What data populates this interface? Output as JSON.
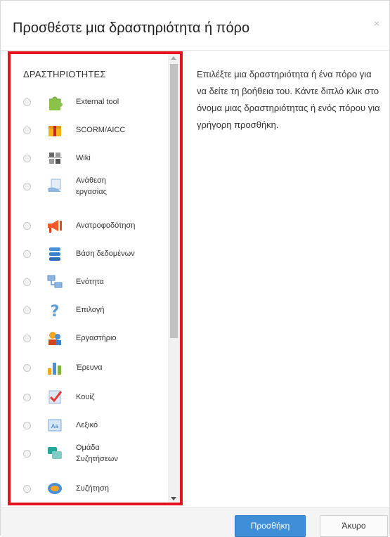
{
  "dialog": {
    "title": "Προσθέστε μια δραστηριότητα ή πόρο",
    "close_glyph": "×"
  },
  "activities": {
    "section_title": "ΔΡΑΣΤΗΡΙΟΤΗΤΕΣ",
    "items": [
      {
        "label": "External tool",
        "icon": "puzzle-icon"
      },
      {
        "label": "SCORM/AICC",
        "icon": "package-icon"
      },
      {
        "label": "Wiki",
        "icon": "wiki-icon"
      },
      {
        "label": "Ανάθεση εργασίας",
        "icon": "assignment-icon"
      },
      {
        "label": "Ανατροφοδότηση",
        "icon": "megaphone-icon"
      },
      {
        "label": "Βάση δεδομένων",
        "icon": "database-icon"
      },
      {
        "label": "Ενότητα",
        "icon": "lesson-icon"
      },
      {
        "label": "Επιλογή",
        "icon": "question-icon"
      },
      {
        "label": "Εργαστήριο",
        "icon": "workshop-icon"
      },
      {
        "label": "Έρευνα",
        "icon": "survey-chart-icon"
      },
      {
        "label": "Κουίζ",
        "icon": "quiz-check-icon"
      },
      {
        "label": "Λεξικό",
        "icon": "glossary-icon"
      },
      {
        "label": "Ομάδα Συζητήσεων",
        "icon": "forum-icon"
      },
      {
        "label": "Συζήτηση",
        "icon": "chat-icon"
      }
    ]
  },
  "help": {
    "text": "Επιλέξτε μια δραστηριότητα ή ένα πόρο για να δείτε τη βοήθεια του. Κάντε διπλό κλικ στο όνομα μιας δραστηριότητας ή ενός πόρου για γρήγορη προσθήκη."
  },
  "footer": {
    "add_label": "Προσθήκη",
    "cancel_label": "Άκυρο"
  },
  "colors": {
    "highlight_border": "#e4131f",
    "primary_button": "#3f8fd8"
  }
}
